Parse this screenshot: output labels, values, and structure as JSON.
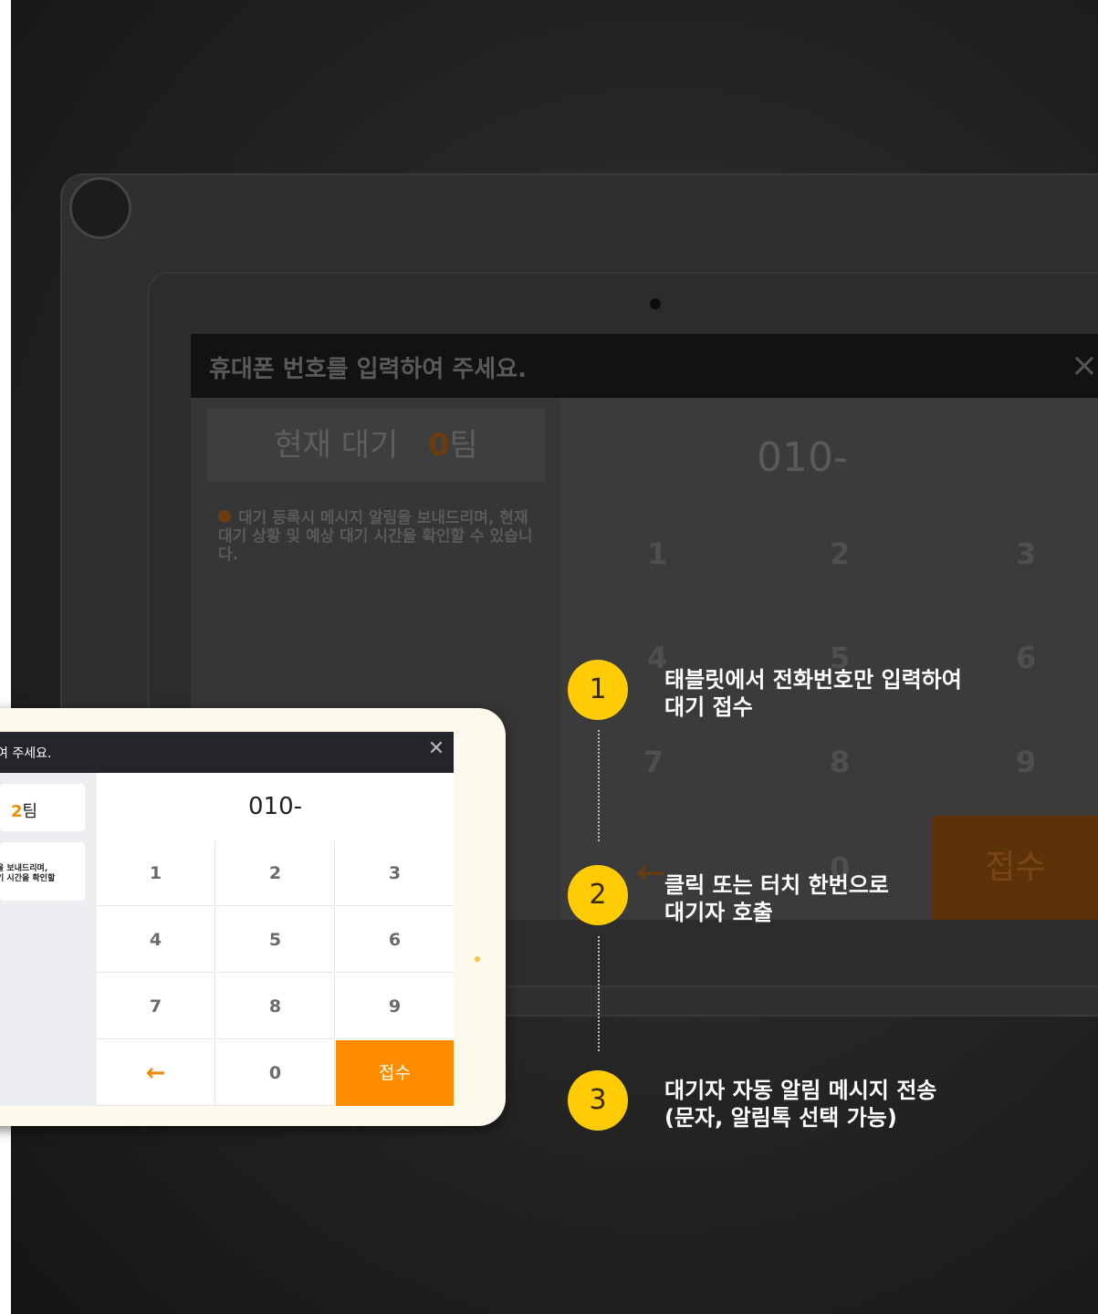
{
  "background_tablet": {
    "title": "휴대폰 번호를 입력하여 주세요.",
    "close": "×",
    "wait_label": "현재 대기",
    "wait_count": "0",
    "wait_unit": "팀",
    "notice": "대기 등록시 메시지 알림을 보내드리며, 현재 대기 상황 및 예상 대기 시간을 확인할 수 있습니다.",
    "display": "010-",
    "keys": [
      "1",
      "2",
      "3",
      "4",
      "5",
      "6",
      "7",
      "8",
      "9",
      "←",
      "0",
      "접수"
    ]
  },
  "tablet": {
    "title": "여 주세요.",
    "close": "✕",
    "wait_count": "2",
    "wait_unit": "팀",
    "notice": "을 보내드리며,\n기 시간을 확인할",
    "display": "010-",
    "keys": {
      "k1": "1",
      "k2": "2",
      "k3": "3",
      "k4": "4",
      "k5": "5",
      "k6": "6",
      "k7": "7",
      "k8": "8",
      "k9": "9",
      "back": "←",
      "k0": "0",
      "accept": "접수"
    }
  },
  "steps": [
    {
      "number": "1",
      "text": "태블릿에서 전화번호만 입력하여\n대기 접수"
    },
    {
      "number": "2",
      "text": "클릭 또는 터치 한번으로\n대기자 호출"
    },
    {
      "number": "3",
      "text": "대기자 자동 알림 메시지 전송\n(문자, 알림톡 선택 가능)"
    }
  ],
  "colors": {
    "accent": "#ff8c00",
    "step_circle": "#ffcb05",
    "header": "#23252b"
  }
}
